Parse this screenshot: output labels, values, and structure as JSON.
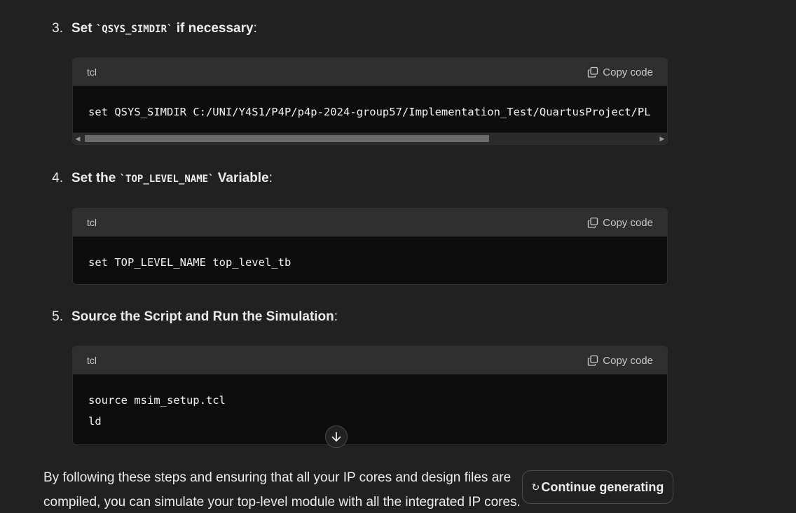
{
  "steps": [
    {
      "number": "3.",
      "title_pre": "Set ",
      "code": "`QSYS_SIMDIR`",
      "title_post": " if necessary",
      "colon": ":"
    },
    {
      "number": "4.",
      "title_pre": "Set the ",
      "code": "`TOP_LEVEL_NAME`",
      "title_post": " Variable",
      "colon": ":"
    },
    {
      "number": "5.",
      "title_pre": "Source the Script and Run the Simulation",
      "code": "",
      "title_post": "",
      "colon": ":"
    }
  ],
  "code_blocks": [
    {
      "lang": "tcl",
      "copy_label": "Copy code",
      "code": "set QSYS_SIMDIR C:/UNI/Y4S1/P4P/p4p-2024-group57/Implementation_Test/QuartusProject/PL"
    },
    {
      "lang": "tcl",
      "copy_label": "Copy code",
      "code": "set TOP_LEVEL_NAME top_level_tb"
    },
    {
      "lang": "tcl",
      "copy_label": "Copy code",
      "code": "source msim_setup.tcl\nld"
    }
  ],
  "paragraph": "By following these steps and ensuring that all your IP cores and design files are compiled, you can simulate your top-level module with all the integrated IP cores.",
  "continue_button": {
    "label": "Continue generating",
    "icon": "refresh-icon"
  },
  "scroll_down": {
    "icon": "arrow-down-icon"
  }
}
